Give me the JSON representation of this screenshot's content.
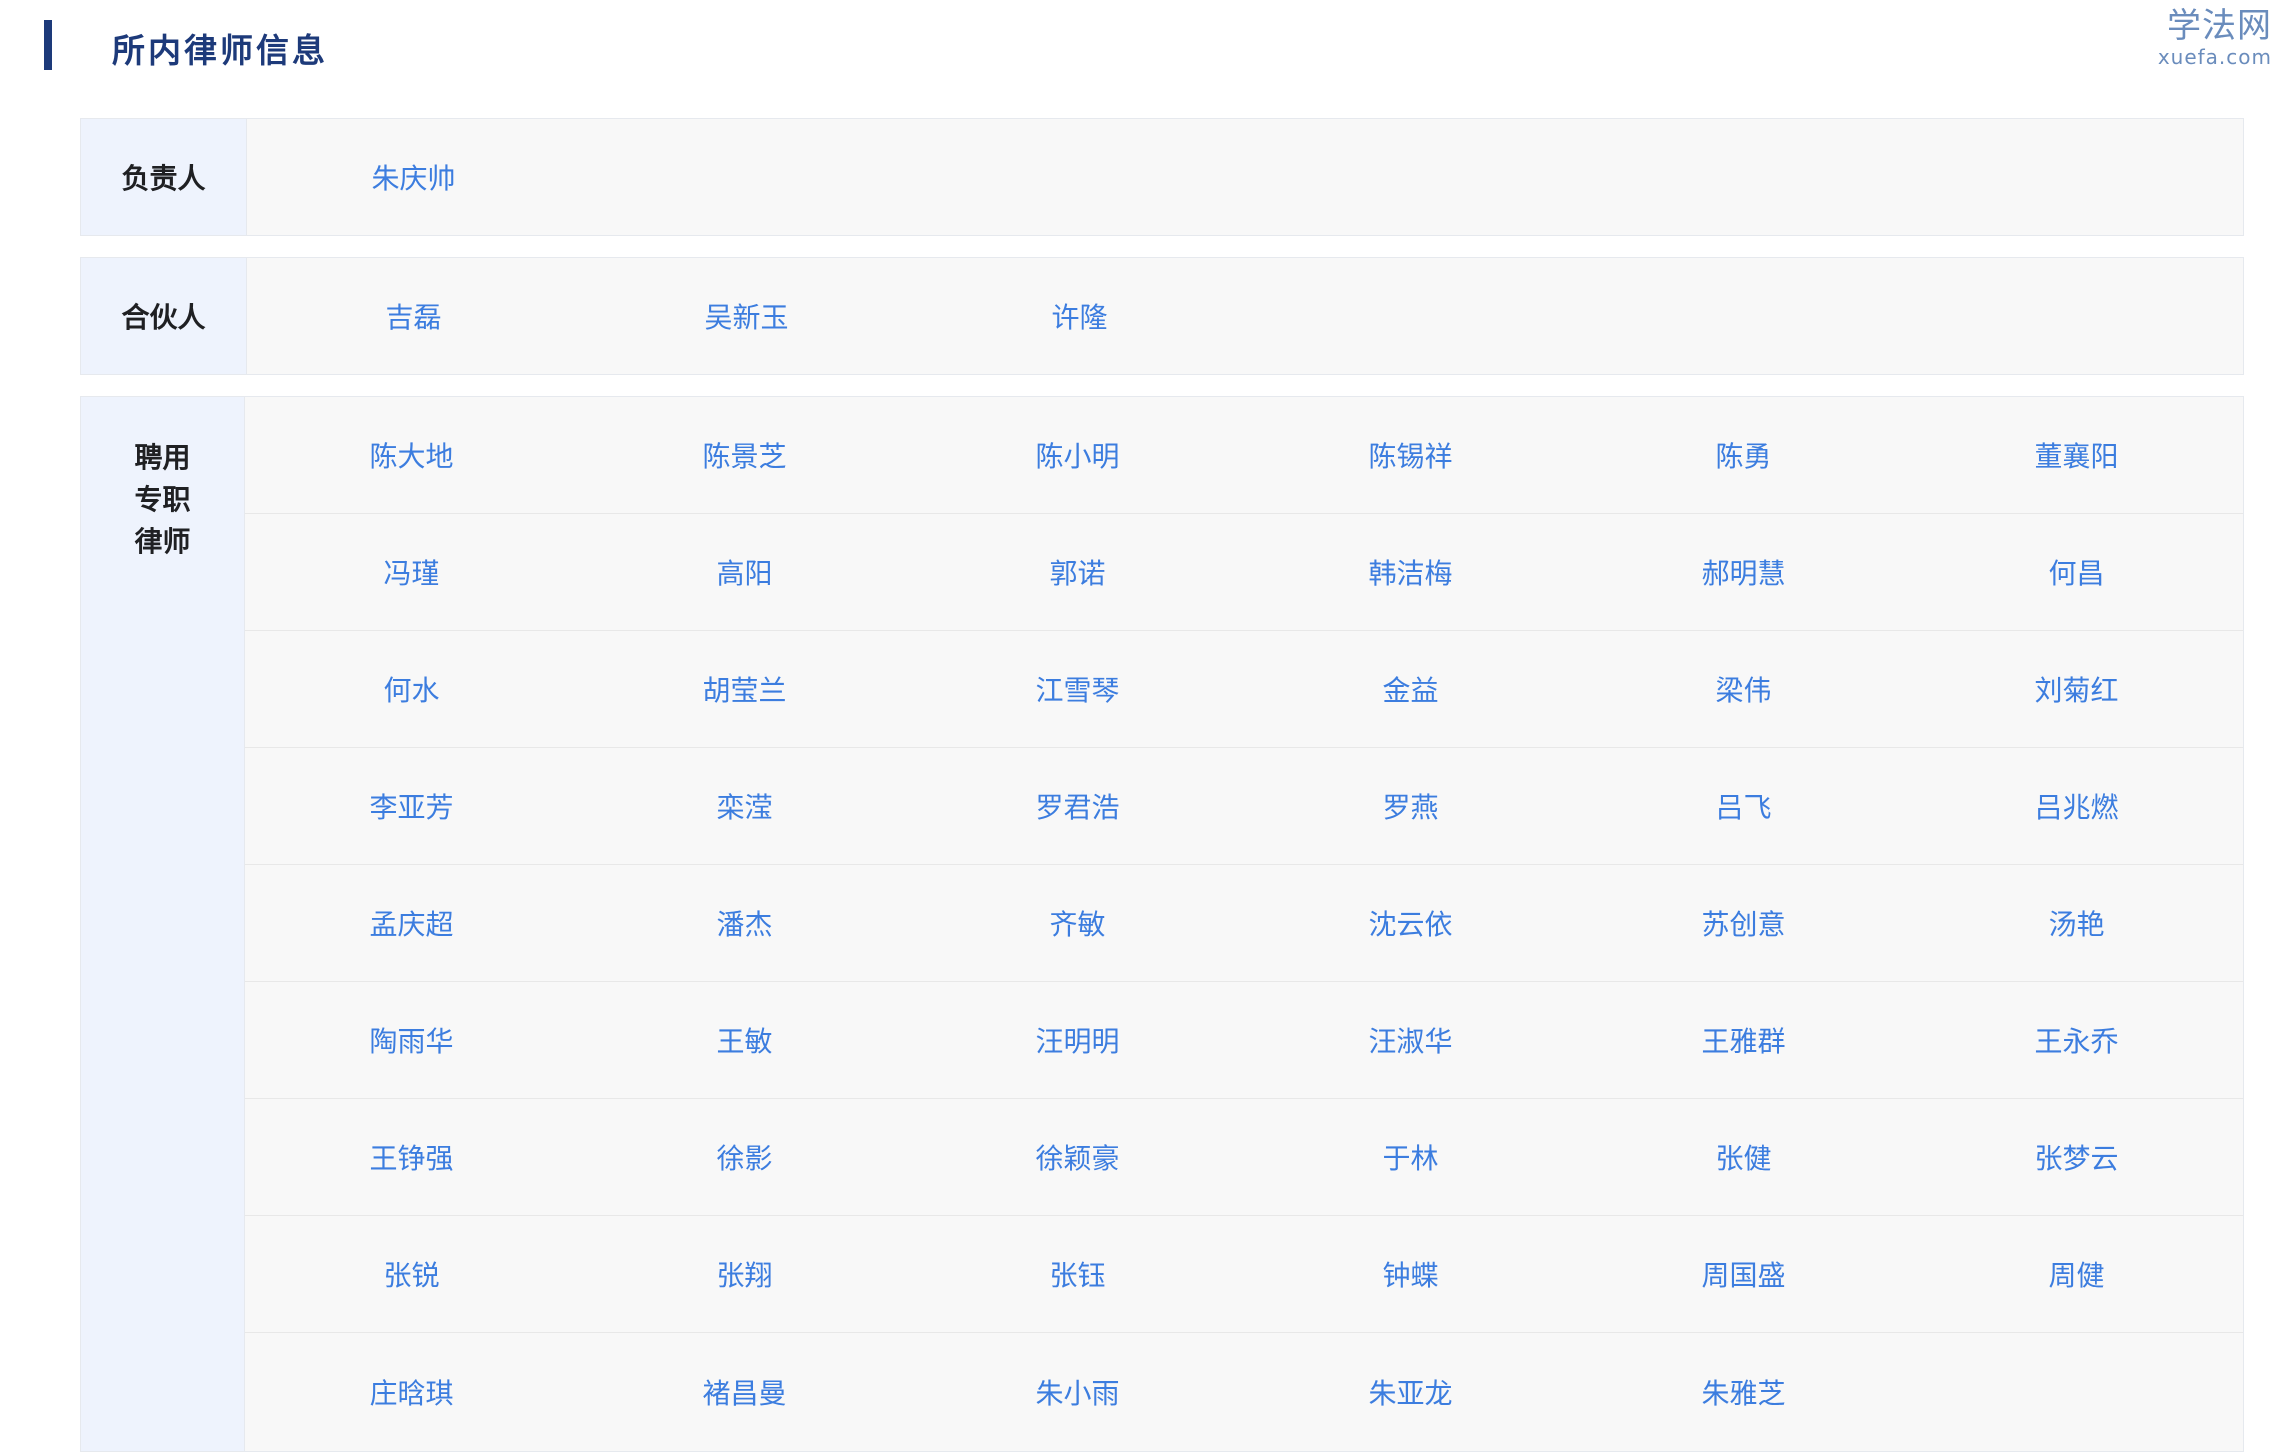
{
  "header": {
    "title": "所内律师信息"
  },
  "logo": {
    "cn": "学法网",
    "en": "xuefa.com"
  },
  "sections": [
    {
      "label": "负责人",
      "rows": [
        [
          "朱庆帅"
        ]
      ]
    },
    {
      "label": "合伙人",
      "rows": [
        [
          "吉磊",
          "吴新玉",
          "许隆"
        ]
      ]
    },
    {
      "label": "聘用\n专职\n律师",
      "rows": [
        [
          "陈大地",
          "陈景芝",
          "陈小明",
          "陈锡祥",
          "陈勇",
          "董襄阳"
        ],
        [
          "冯瑾",
          "高阳",
          "郭诺",
          "韩洁梅",
          "郝明慧",
          "何昌"
        ],
        [
          "何水",
          "胡莹兰",
          "江雪琴",
          "金益",
          "梁伟",
          "刘菊红"
        ],
        [
          "李亚芳",
          "栾滢",
          "罗君浩",
          "罗燕",
          "吕飞",
          "吕兆燃"
        ],
        [
          "孟庆超",
          "潘杰",
          "齐敏",
          "沈云依",
          "苏创意",
          "汤艳"
        ],
        [
          "陶雨华",
          "王敏",
          "汪明明",
          "汪淑华",
          "王雅群",
          "王永乔"
        ],
        [
          "王铮强",
          "徐影",
          "徐颖豪",
          "于林",
          "张健",
          "张梦云"
        ],
        [
          "张锐",
          "张翔",
          "张钰",
          "钟蝶",
          "周国盛",
          "周健"
        ],
        [
          "庄晗琪",
          "褚昌曼",
          "朱小雨",
          "朱亚龙",
          "朱雅芝"
        ]
      ]
    }
  ]
}
